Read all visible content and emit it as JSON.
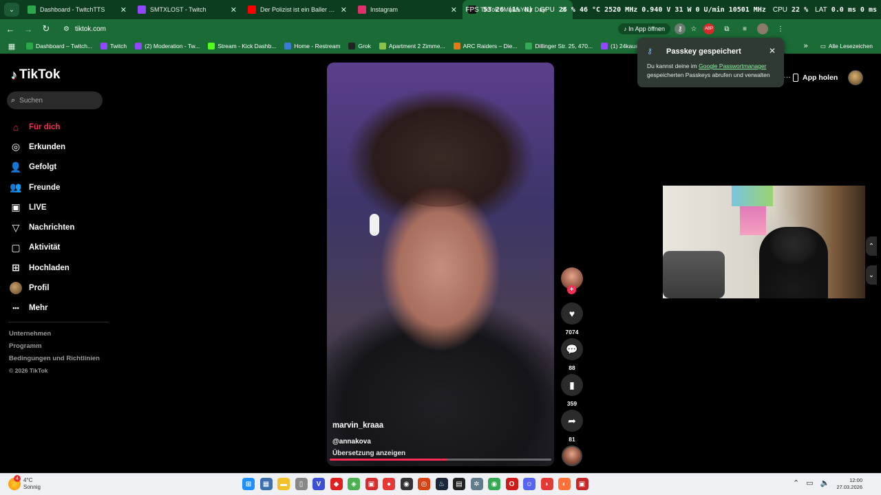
{
  "browser": {
    "tabs": [
      {
        "title": "Dashboard - TwitchTTS",
        "color": "#2aa84a"
      },
      {
        "title": "SMTXLOST - Twitch",
        "color": "#9146ff"
      },
      {
        "title": "Der Polizist ist ein Baller #moi",
        "color": "#ff0000"
      },
      {
        "title": "Instagram",
        "color": "#e1306c"
      },
      {
        "title": "TikTok - Make Your Day",
        "color": "#111111"
      }
    ],
    "active_tab_index": 4,
    "hud": {
      "fps_label": "FPS",
      "fps_value": "53",
      "fps_extra": "26 (1% N)",
      "gpu_label": "GPU",
      "gpu_value": "25 % 46 °C 2520 MHz 0.940 V 31 W 0 U/min 10501 MHz",
      "cpu_label": "CPU",
      "cpu_value": "22 %",
      "lat_label": "LAT",
      "lat_value": "0.0 ms 0 ms"
    },
    "url": "tiktok.com",
    "in_app_label": "In App öffnen",
    "bookmarks": [
      {
        "label": "Dashboard – Twitch...",
        "color": "#2aa84a"
      },
      {
        "label": "Twitch",
        "color": "#9146ff"
      },
      {
        "label": "(2) Moderation - Tw...",
        "color": "#9146ff"
      },
      {
        "label": "Stream - Kick Dashb...",
        "color": "#53fc18"
      },
      {
        "label": "Home - Restream",
        "color": "#3a7bd5"
      },
      {
        "label": "Grok",
        "color": "#222222"
      },
      {
        "label": "Apartment 2 Zimme...",
        "color": "#8bc34a"
      },
      {
        "label": "ARC Raiders – Die...",
        "color": "#e07b1a"
      },
      {
        "label": "Dillinger Str. 25, 470...",
        "color": "#34a853"
      },
      {
        "label": "(1) 24kauss - Twitch",
        "color": "#9146ff"
      }
    ],
    "more_bookmarks": "»",
    "all_bookmarks_label": "Alle Lesezeichen"
  },
  "tiktok": {
    "logo": "TikTok",
    "search_placeholder": "Suchen",
    "nav": [
      {
        "label": "Für dich",
        "icon": "home-icon",
        "glyph": "⌂",
        "active": true
      },
      {
        "label": "Erkunden",
        "icon": "compass-icon",
        "glyph": "◎",
        "active": false
      },
      {
        "label": "Gefolgt",
        "icon": "person-plus-icon",
        "glyph": "👤",
        "active": false
      },
      {
        "label": "Freunde",
        "icon": "friends-icon",
        "glyph": "👥",
        "active": false
      },
      {
        "label": "LIVE",
        "icon": "live-icon",
        "glyph": "▣",
        "active": false
      },
      {
        "label": "Nachrichten",
        "icon": "send-icon",
        "glyph": "▽",
        "active": false
      },
      {
        "label": "Aktivität",
        "icon": "activity-icon",
        "glyph": "▢",
        "active": false
      },
      {
        "label": "Hochladen",
        "icon": "upload-icon",
        "glyph": "⊞",
        "active": false
      },
      {
        "label": "Profil",
        "icon": "profile-avatar",
        "glyph": "",
        "active": false
      },
      {
        "label": "Mehr",
        "icon": "more-icon",
        "glyph": "•••",
        "active": false
      }
    ],
    "footer_links": [
      "Unternehmen",
      "Programm",
      "Bedingungen und Richtlinien"
    ],
    "copyright": "© 2026 TikTok",
    "app_holen": "App holen",
    "video": {
      "username": "marvin_kraaa",
      "mention": "@annakova",
      "translate": "Übersetzung anzeigen",
      "progress": 0.53
    },
    "actions": {
      "likes": "7074",
      "comments": "88",
      "saves": "359",
      "shares": "81"
    }
  },
  "passkey_popup": {
    "title": "Passkey gespeichert",
    "body_prefix": "Du kannst deine im ",
    "link": "Google Passwortmanager",
    "body_suffix": " gespeicherten Passkeys abrufen und verwalten"
  },
  "taskbar": {
    "weather_temp": "4°C",
    "weather_desc": "Sonnig",
    "weather_badge": "4",
    "apps": [
      {
        "name": "windows-start-icon",
        "color": "#1e90ff",
        "glyph": "⊞"
      },
      {
        "name": "calculator-icon",
        "color": "#3a6fb0",
        "glyph": "▦"
      },
      {
        "name": "file-explorer-icon",
        "color": "#f2c029",
        "glyph": "▬"
      },
      {
        "name": "mouse-icon",
        "color": "#888888",
        "glyph": "▯"
      },
      {
        "name": "app-v-icon",
        "color": "#3b4fd8",
        "glyph": "V"
      },
      {
        "name": "app-red-icon",
        "color": "#e02020",
        "glyph": "◆"
      },
      {
        "name": "app-multicolor-icon",
        "color": "#4caf50",
        "glyph": "◈"
      },
      {
        "name": "app-stream-icon",
        "color": "#d32f2f",
        "glyph": "▣"
      },
      {
        "name": "app-record-icon",
        "color": "#e53935",
        "glyph": "●"
      },
      {
        "name": "obs-icon",
        "color": "#333333",
        "glyph": "◉"
      },
      {
        "name": "app-orange-icon",
        "color": "#d84315",
        "glyph": "◎"
      },
      {
        "name": "steam-icon",
        "color": "#1b2838",
        "glyph": "♨"
      },
      {
        "name": "app-dark-icon",
        "color": "#222222",
        "glyph": "▤"
      },
      {
        "name": "app-tool-icon",
        "color": "#607d8b",
        "glyph": "✲"
      },
      {
        "name": "chrome-icon",
        "color": "#34a853",
        "glyph": "◉"
      },
      {
        "name": "opera-icon",
        "color": "#d01b1b",
        "glyph": "O"
      },
      {
        "name": "discord-icon",
        "color": "#5865f2",
        "glyph": "☺"
      },
      {
        "name": "app-bird-icon",
        "color": "#e53935",
        "glyph": "◗"
      },
      {
        "name": "firefox-icon",
        "color": "#ff7139",
        "glyph": "◐"
      },
      {
        "name": "app-stream2-icon",
        "color": "#c62828",
        "glyph": "▣"
      }
    ],
    "time": "12:00",
    "date": "27.03.2026"
  }
}
